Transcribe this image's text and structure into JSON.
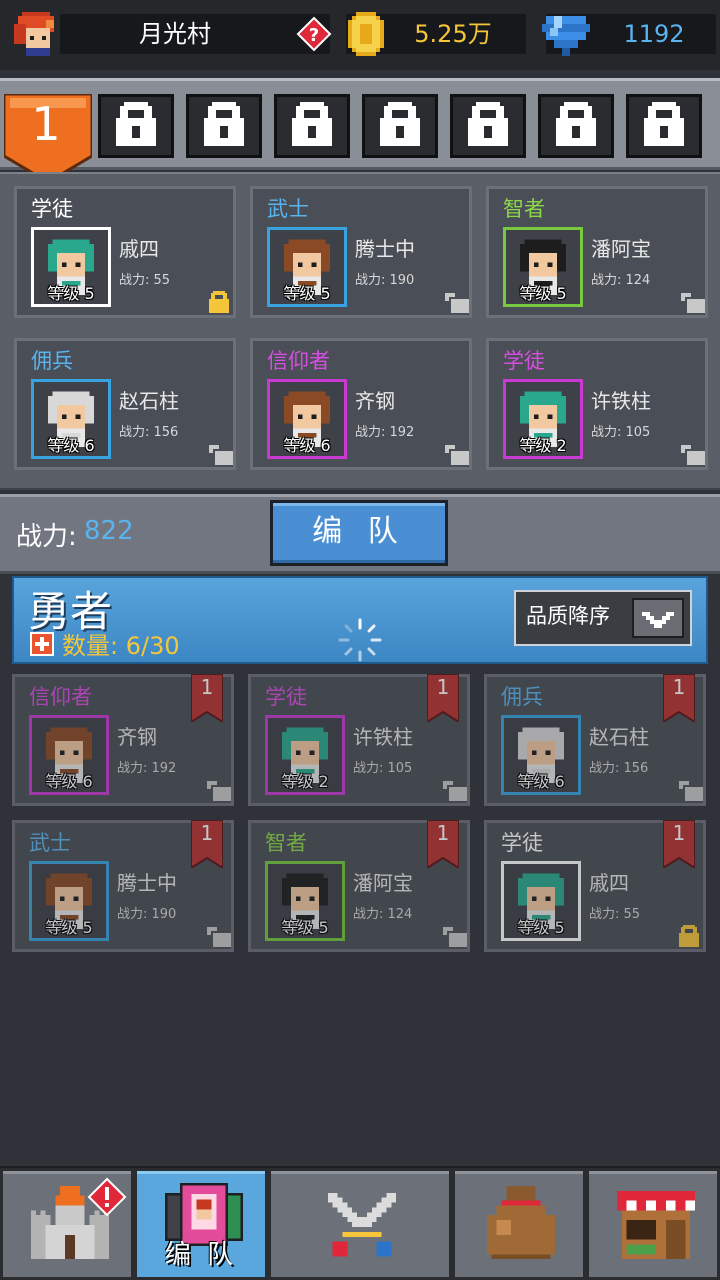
{
  "header": {
    "village_name": "月光村",
    "coins": "5.25万",
    "gems": "1192"
  },
  "team_tabs": {
    "active_label": "1",
    "locked_count": 7
  },
  "team_slots": [
    {
      "class": "学徒",
      "class_color": "#ffffff",
      "name": "戚四",
      "power": "战力: 55",
      "level": "等级 5",
      "frame": "#ffffff",
      "hair": "#2aa88e",
      "lock": "gold"
    },
    {
      "class": "武士",
      "class_color": "#5ab4ef",
      "name": "腾士中",
      "power": "战力: 190",
      "level": "等级 5",
      "frame": "#38a3e0",
      "hair": "#8a4a26",
      "lock": "gray"
    },
    {
      "class": "智者",
      "class_color": "#8cd74a",
      "name": "潘阿宝",
      "power": "战力: 124",
      "level": "等级 5",
      "frame": "#78c840",
      "hair": "#1d1d1d",
      "lock": "gray"
    },
    {
      "class": "佣兵",
      "class_color": "#5ab4ef",
      "name": "赵石柱",
      "power": "战力: 156",
      "level": "等级 6",
      "frame": "#38a3e0",
      "hair": "#d8d8d8",
      "lock": "gray"
    },
    {
      "class": "信仰者",
      "class_color": "#d84ee0",
      "name": "齐钢",
      "power": "战力: 192",
      "level": "等级 6",
      "frame": "#c93ad3",
      "hair": "#8a4a26",
      "lock": "gray"
    },
    {
      "class": "学徒",
      "class_color": "#d84ee0",
      "name": "许铁柱",
      "power": "战力: 105",
      "level": "等级 2",
      "frame": "#c93ad3",
      "hair": "#2aa88e",
      "lock": "gray"
    }
  ],
  "power_row": {
    "label": "战力:",
    "value": "822",
    "button": "编 队"
  },
  "hero_list": {
    "title": "勇者",
    "count_label": "数量: 6/30",
    "sort_label": "品质降序"
  },
  "hero_cards": [
    {
      "class": "信仰者",
      "class_color": "#d84ee0",
      "name": "齐钢",
      "power": "战力: 192",
      "level": "等级 6",
      "frame": "#c93ad3",
      "hair": "#8a4a26",
      "flag": "1",
      "lock": "gray"
    },
    {
      "class": "学徒",
      "class_color": "#d84ee0",
      "name": "许铁柱",
      "power": "战力: 105",
      "level": "等级 2",
      "frame": "#c93ad3",
      "hair": "#2aa88e",
      "flag": "1",
      "lock": "gray"
    },
    {
      "class": "佣兵",
      "class_color": "#5ab4ef",
      "name": "赵石柱",
      "power": "战力: 156",
      "level": "等级 6",
      "frame": "#38a3e0",
      "hair": "#d8d8d8",
      "flag": "1",
      "lock": "gray"
    },
    {
      "class": "武士",
      "class_color": "#5ab4ef",
      "name": "腾士中",
      "power": "战力: 190",
      "level": "等级 5",
      "frame": "#38a3e0",
      "hair": "#8a4a26",
      "flag": "1",
      "lock": "gray"
    },
    {
      "class": "智者",
      "class_color": "#8cd74a",
      "name": "潘阿宝",
      "power": "战力: 124",
      "level": "等级 5",
      "frame": "#78c840",
      "hair": "#1d1d1d",
      "flag": "1",
      "lock": "gray"
    },
    {
      "class": "学徒",
      "class_color": "#ffffff",
      "name": "戚四",
      "power": "战力: 55",
      "level": "等级 5",
      "frame": "#ffffff",
      "hair": "#2aa88e",
      "flag": "1",
      "lock": "gold"
    }
  ],
  "bottom_nav": [
    {
      "icon": "castle-icon",
      "label": ""
    },
    {
      "icon": "team-cards-icon",
      "label": "编 队",
      "active": true
    },
    {
      "icon": "crossed-swords-icon",
      "label": ""
    },
    {
      "icon": "loot-bag-icon",
      "label": ""
    },
    {
      "icon": "shop-icon",
      "label": ""
    }
  ],
  "colors": {
    "accent_blue": "#4a8fd3",
    "coin_gold": "#f6c63a",
    "gem_blue": "#5ab4ef",
    "alert_red": "#e0283a",
    "team_orange": "#ee6f1f"
  }
}
